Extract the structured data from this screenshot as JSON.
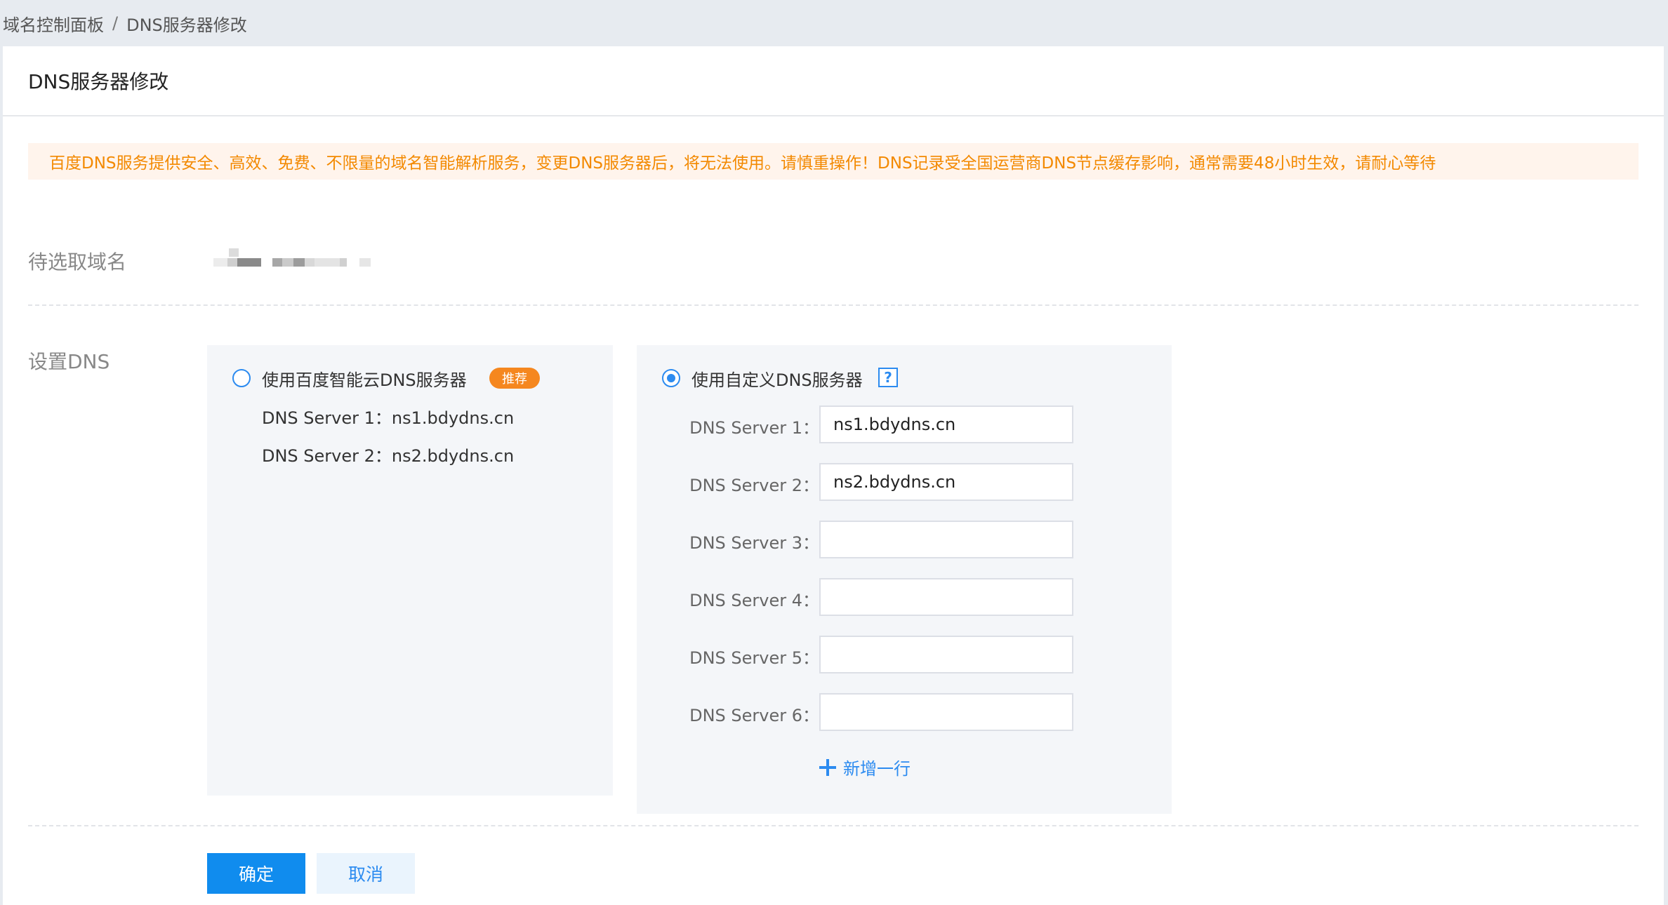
{
  "breadcrumb": {
    "root": "域名控制面板",
    "separator": "/",
    "current": "DNS服务器修改"
  },
  "panel": {
    "title": "DNS服务器修改"
  },
  "notice": {
    "text": "百度DNS服务提供安全、高效、免费、不限量的域名智能解析服务，变更DNS服务器后，将无法使用。请慎重操作！DNS记录受全国运营商DNS节点缓存影响，通常需要48小时生效，请耐心等待"
  },
  "domain_row": {
    "label": "待选取域名"
  },
  "dns_row": {
    "label": "设置DNS"
  },
  "option_baidu": {
    "label": "使用百度智能云DNS服务器",
    "badge": "推荐",
    "selected": false,
    "servers": [
      "DNS Server 1：ns1.bdydns.cn",
      "DNS Server 2：ns2.bdydns.cn"
    ]
  },
  "option_custom": {
    "label": "使用自定义DNS服务器",
    "help_glyph": "?",
    "selected": true,
    "fields": [
      {
        "label": "DNS Server 1：",
        "value": "ns1.bdydns.cn"
      },
      {
        "label": "DNS Server 2：",
        "value": "ns2.bdydns.cn"
      },
      {
        "label": "DNS Server 3：",
        "value": ""
      },
      {
        "label": "DNS Server 4：",
        "value": ""
      },
      {
        "label": "DNS Server 5：",
        "value": ""
      },
      {
        "label": "DNS Server 6：",
        "value": ""
      }
    ],
    "add_row_label": "新增一行"
  },
  "actions": {
    "confirm": "确定",
    "cancel": "取消"
  },
  "colors": {
    "primary": "#108cee",
    "link": "#2c8bf0",
    "warning": "#f38900",
    "badge": "#f5871f"
  }
}
